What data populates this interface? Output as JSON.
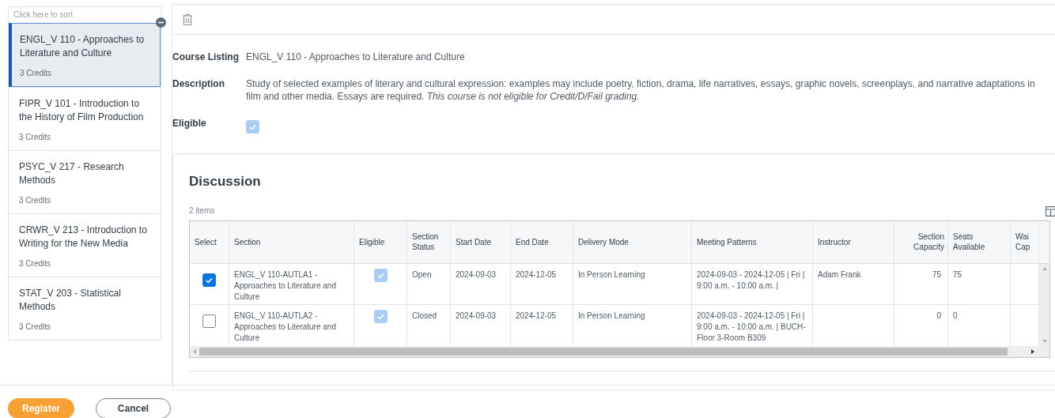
{
  "sidebar": {
    "sort_hint": "Click here to sort",
    "items": [
      {
        "title": "ENGL_V 110 - Approaches to Literature and Culture",
        "credits": "3 Credits",
        "selected": true
      },
      {
        "title": "FIPR_V 101 - Introduction to the History of Film Production",
        "credits": "3 Credits",
        "selected": false
      },
      {
        "title": "PSYC_V 217 - Research Methods",
        "credits": "3 Credits",
        "selected": false
      },
      {
        "title": "CRWR_V 213 - Introduction to Writing for the New Media",
        "credits": "3 Credits",
        "selected": false
      },
      {
        "title": "STAT_V 203 - Statistical Methods",
        "credits": "3 Credits",
        "selected": false
      }
    ]
  },
  "details": {
    "fields": [
      {
        "label": "Course Listing",
        "kind": "text",
        "value": "ENGL_V 110 - Approaches to Literature and Culture"
      },
      {
        "label": "Description",
        "kind": "text",
        "value": "Study of selected examples of literary and cultural expression: examples may include poetry, fiction, drama, life narratives, essays, graphic novels, screenplays, and narrative adaptations in film and other media. Essays are required. *This course is not eligible for Credit/D/Fail grading.*"
      },
      {
        "label": "Eligible",
        "kind": "checkbox",
        "checked": true
      }
    ]
  },
  "discussion": {
    "title": "Discussion",
    "count": "2 items",
    "columns": [
      {
        "label": "Select",
        "kind": "select"
      },
      {
        "label": "Section",
        "kind": "text"
      },
      {
        "label": "Eligible",
        "kind": "eligible"
      },
      {
        "label": "Section Status",
        "kind": "text"
      },
      {
        "label": "Start Date",
        "kind": "text"
      },
      {
        "label": "End Date",
        "kind": "text"
      },
      {
        "label": "Delivery Mode",
        "kind": "text"
      },
      {
        "label": "Meeting Patterns",
        "kind": "text"
      },
      {
        "label": "Instructor",
        "kind": "text"
      },
      {
        "label": "Section Capacity",
        "kind": "number"
      },
      {
        "label": "Seats Available",
        "kind": "text"
      },
      {
        "label": "Wai Cap",
        "kind": "text"
      }
    ],
    "rows": [
      {
        "cells": [
          {
            "selected": true
          },
          "ENGL_V 110-AUTLA1 - Approaches to Literature and Culture",
          {
            "checked": true
          },
          "Open",
          "2024-09-03",
          "2024-12-05",
          "In Person Learning",
          "2024-09-03 - 2024-12-05 | Fri | 9:00 a.m. - 10:00 a.m. |",
          "Adam Frank",
          "75",
          "75",
          null
        ]
      },
      {
        "cells": [
          {
            "selected": false
          },
          "ENGL_V 110-AUTLA2 - Approaches to Literature and Culture",
          {
            "checked": true
          },
          "Closed",
          "2024-09-03",
          "2024-12-05",
          "In Person Learning",
          "2024-09-03 - 2024-12-05 | Fri | 9:00 a.m. - 10:00 a.m. | BUCH-Floor 3-Room B309",
          null,
          "0",
          "0",
          null
        ]
      }
    ]
  },
  "buttons": [
    {
      "label": "Register",
      "kind": "primary"
    },
    {
      "label": "Cancel",
      "kind": "secondary"
    }
  ]
}
